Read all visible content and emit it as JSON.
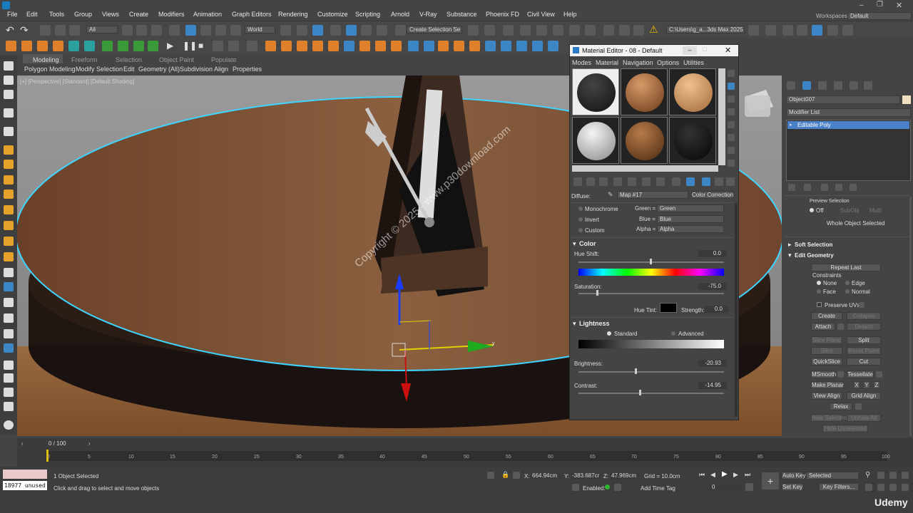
{
  "menubar": {
    "items": [
      "File",
      "Edit",
      "Tools",
      "Group",
      "Views",
      "Create",
      "Modifiers",
      "Animation",
      "Graph Editors",
      "Rendering",
      "Customize",
      "Scripting",
      "Arnold",
      "V-Ray",
      "Substance",
      "Phoenix FD",
      "Civil View",
      "Help"
    ],
    "workspaces_label": "Workspaces:",
    "workspaces_value": "Default"
  },
  "toolbar": {
    "filter_value": "All",
    "coord_value": "World",
    "selection_set_placeholder": "Create Selection Se",
    "path_value": "C:\\Users\\g_a...3ds Max 2025"
  },
  "ribbon": {
    "tabs": [
      "Modeling",
      "Freeform",
      "Selection",
      "Object Paint",
      "Populate"
    ],
    "sub_items": [
      "Polygon Modeling",
      "Modify Selection",
      "Edit",
      "Geometry (All)",
      "Subdivision",
      "Align",
      "Properties"
    ]
  },
  "viewport": {
    "label": "[+] [Perspective] [Standard] [Default Shading]",
    "watermark": "Copyright © 2025 - www.p30download.com",
    "axis_y": "y",
    "axis_x": "x"
  },
  "material_editor": {
    "title": "Material Editor - 08 - Default",
    "menu": [
      "Modes",
      "Material",
      "Navigation",
      "Options",
      "Utilities"
    ],
    "diffuse_label": "Diffuse:",
    "map_value": "Map #17",
    "color_correction": "Color Correction",
    "channels": [
      {
        "label": "Monochrome",
        "ch_label": "Green =",
        "ch_value": "Green"
      },
      {
        "label": "Invert",
        "ch_label": "Blue =",
        "ch_value": "Blue"
      },
      {
        "label": "Custom",
        "ch_label": "Alpha =",
        "ch_value": "Alpha"
      }
    ],
    "color_section": "Color",
    "hue_shift_label": "Hue Shift:",
    "hue_shift_value": "0.0",
    "saturation_label": "Saturation:",
    "saturation_value": "-75.0",
    "hue_tint_label": "Hue Tint:",
    "strength_label": "Strength:",
    "strength_value": "0.0",
    "lightness_section": "Lightness",
    "standard_label": "Standard",
    "advanced_label": "Advanced",
    "brightness_label": "Brightness:",
    "brightness_value": "-20.93",
    "contrast_label": "Contrast:",
    "contrast_value": "-14.95"
  },
  "command_panel": {
    "object_name": "Object007",
    "modifier_list": "Modifier List",
    "stack_item": "Editable Poly",
    "preview_selection": "Preview Selection",
    "off": "Off",
    "subobj": "SubObj",
    "multi": "Multi",
    "whole_object": "Whole Object Selected",
    "soft_selection": "Soft Selection",
    "edit_geometry": "Edit Geometry",
    "repeat_last": "Repeat Last",
    "constraints": "Constraints",
    "none": "None",
    "edge": "Edge",
    "face": "Face",
    "normal": "Normal",
    "preserve_uvs": "Preserve UVs",
    "create": "Create",
    "collapse": "Collapse",
    "attach": "Attach",
    "detach": "Detach",
    "slice_plane": "Slice Plane",
    "split": "Split",
    "slice": "Slice",
    "reset_plane": "Reset Plane",
    "quickslice": "QuickSlice",
    "cut": "Cut",
    "msmooth": "MSmooth",
    "tessellate": "Tessellate",
    "make_planar": "Make Planar",
    "x": "X",
    "y": "Y",
    "z": "Z",
    "view_align": "View Align",
    "grid_align": "Grid Align",
    "relax": "Relax",
    "hide_selected": "Hide Selected",
    "unhide_all": "Unhide All",
    "hide_unselected": "Hide Unselected"
  },
  "timeline": {
    "frame_counter": "0 / 100",
    "ticks": [
      "0",
      "5",
      "10",
      "15",
      "20",
      "25",
      "30",
      "35",
      "40",
      "45",
      "50",
      "55",
      "60",
      "65",
      "70",
      "75",
      "80",
      "85",
      "90",
      "95",
      "100"
    ]
  },
  "status": {
    "memory": "18977 unused",
    "selected": "1 Object Selected",
    "prompt": "Click and drag to select and move objects",
    "x_label": "X:",
    "x_value": "664.94cm",
    "y_label": "Y:",
    "y_value": "-383.687cr",
    "z_label": "Z:",
    "z_value": "47.969cm",
    "grid": "Grid = 10.0cm",
    "enabled": "Enabled:",
    "add_time_tag": "Add Time Tag",
    "auto_key": "Auto Key",
    "selected_dd": "Selected",
    "set_key": "Set Key",
    "key_filters": "Key Filters...",
    "frame_value": "0",
    "udemy": "Udemy"
  }
}
